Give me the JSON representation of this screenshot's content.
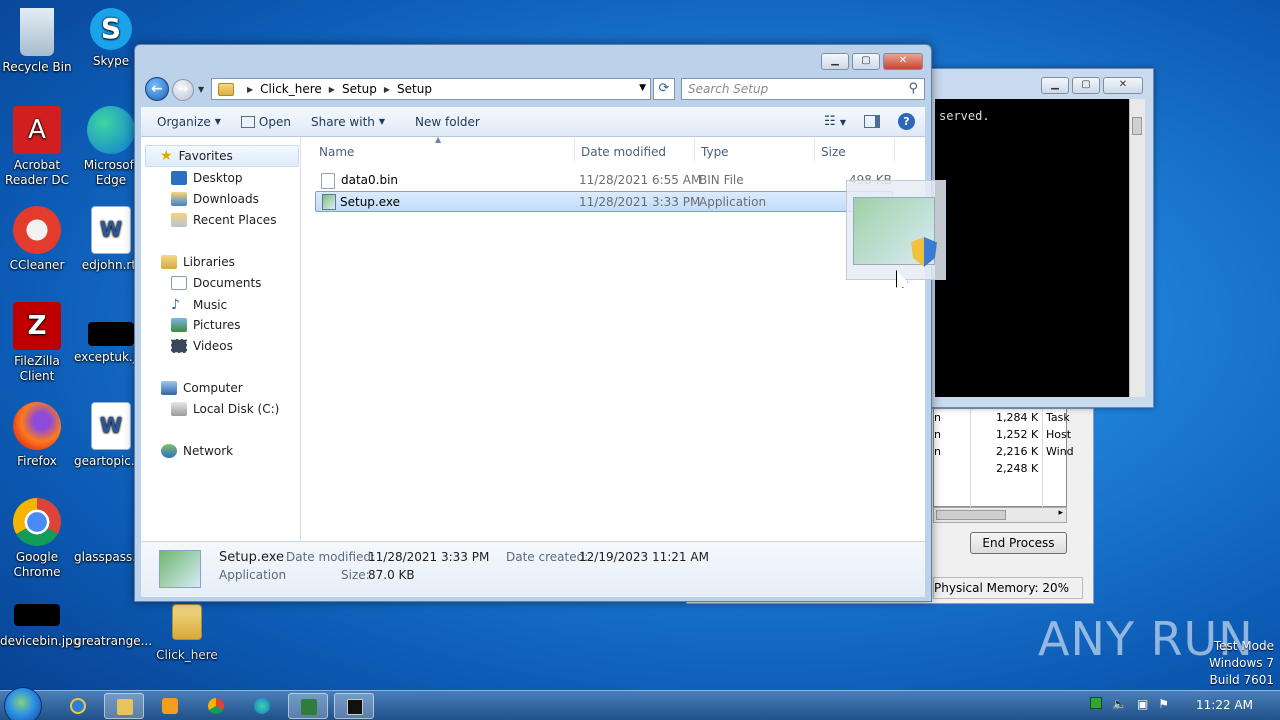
{
  "desktop": {
    "icons": [
      {
        "label": "Recycle Bin"
      },
      {
        "label": "Skype"
      },
      {
        "label": "Acrobat Reader DC"
      },
      {
        "label": "Microsoft Edge"
      },
      {
        "label": "CCleaner"
      },
      {
        "label": "edjohn.rtf"
      },
      {
        "label": "FileZilla Client"
      },
      {
        "label": "exceptuk.jpg"
      },
      {
        "label": "Firefox"
      },
      {
        "label": "geartopic.rtf"
      },
      {
        "label": "Google Chrome"
      },
      {
        "label": "glasspass.rtf"
      },
      {
        "label": "devicebin.jpg"
      },
      {
        "label": "greatrange..."
      },
      {
        "label": "Click_here"
      }
    ]
  },
  "cmd": {
    "text": "served."
  },
  "taskmgr": {
    "rows": [
      {
        "c1": "n",
        "mem": "1,284 K",
        "desc": "Task"
      },
      {
        "c1": "n",
        "mem": "1,252 K",
        "desc": "Host"
      },
      {
        "c1": "n",
        "mem": "2,216 K",
        "desc": "Wind"
      },
      {
        "c1": "",
        "mem": "2,248 K",
        "desc": ""
      }
    ],
    "end_process": "End Process",
    "status": "Physical Memory: 20%"
  },
  "explorer": {
    "breadcrumb": [
      "Click_here",
      "Setup",
      "Setup"
    ],
    "search_placeholder": "Search Setup",
    "toolbar": {
      "organize": "Organize",
      "open": "Open",
      "share_with": "Share with",
      "new_folder": "New folder"
    },
    "nav": {
      "favorites": "Favorites",
      "desktop": "Desktop",
      "downloads": "Downloads",
      "recent": "Recent Places",
      "libraries": "Libraries",
      "documents": "Documents",
      "music": "Music",
      "pictures": "Pictures",
      "videos": "Videos",
      "computer": "Computer",
      "local_disk": "Local Disk (C:)",
      "network": "Network"
    },
    "columns": {
      "name": "Name",
      "date": "Date modified",
      "type": "Type",
      "size": "Size"
    },
    "files": [
      {
        "name": "data0.bin",
        "date": "11/28/2021 6:55 AM",
        "type": "BIN File",
        "size": "498 KB"
      },
      {
        "name": "Setup.exe",
        "date": "11/28/2021 3:33 PM",
        "type": "Application",
        "size": ""
      }
    ],
    "details": {
      "name": "Setup.exe",
      "kind": "Application",
      "modified_label": "Date modified:",
      "modified": "11/28/2021 3:33 PM",
      "created_label": "Date created:",
      "created": "12/19/2023 11:21 AM",
      "size_label": "Size:",
      "size": "87.0 KB"
    }
  },
  "watermark": "ANY RUN",
  "testmode": {
    "line1": "Test Mode",
    "line2": "Windows 7",
    "line3": "Build 7601"
  },
  "clock": "11:22 AM"
}
